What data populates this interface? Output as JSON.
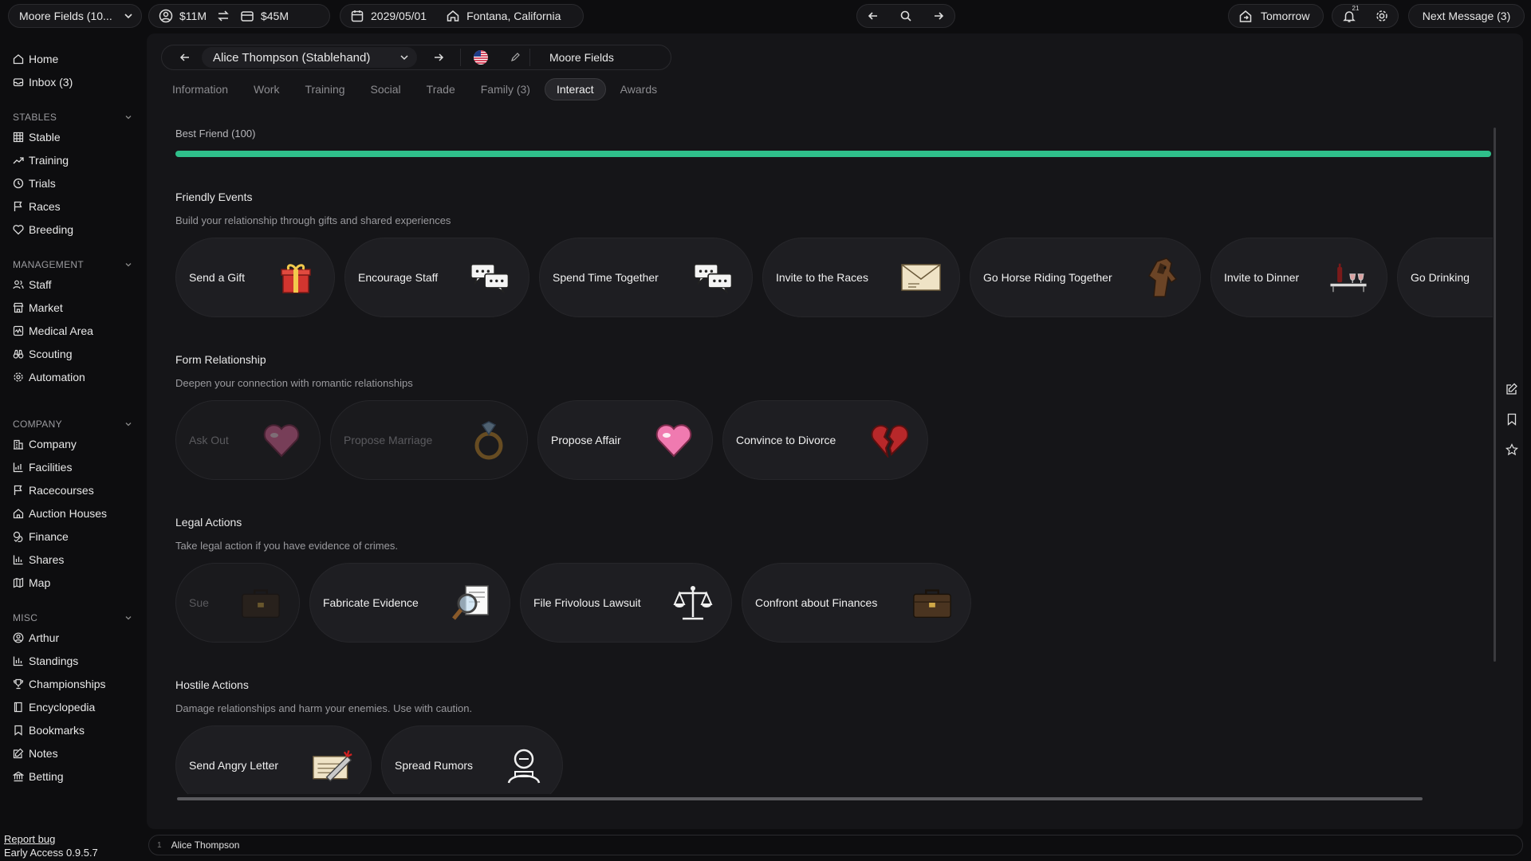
{
  "topbar": {
    "save_select": "Moore Fields (10...",
    "cash": "$11M",
    "assets": "$45M",
    "date": "2029/05/01",
    "location": "Fontana, California",
    "tomorrow": "Tomorrow",
    "notif_count": "21",
    "next_message": "Next Message (3)"
  },
  "sidebar": {
    "top": [
      {
        "label": "Home",
        "icon": "home-icon"
      },
      {
        "label": "Inbox (3)",
        "icon": "inbox-icon"
      }
    ],
    "sections": [
      {
        "title": "STABLES",
        "items": [
          {
            "label": "Stable",
            "icon": "grid-icon"
          },
          {
            "label": "Training",
            "icon": "trend-icon"
          },
          {
            "label": "Trials",
            "icon": "history-icon"
          },
          {
            "label": "Races",
            "icon": "flag-icon"
          },
          {
            "label": "Breeding",
            "icon": "heart-icon"
          }
        ]
      },
      {
        "title": "MANAGEMENT",
        "items": [
          {
            "label": "Staff",
            "icon": "users-icon"
          },
          {
            "label": "Market",
            "icon": "store-icon"
          },
          {
            "label": "Medical Area",
            "icon": "medical-icon"
          },
          {
            "label": "Scouting",
            "icon": "binoculars-icon"
          },
          {
            "label": "Automation",
            "icon": "gear-icon"
          }
        ]
      },
      {
        "title": "COMPANY",
        "items": [
          {
            "label": "Company",
            "icon": "building-icon"
          },
          {
            "label": "Facilities",
            "icon": "chart-icon"
          },
          {
            "label": "Racecourses",
            "icon": "flag-icon"
          },
          {
            "label": "Auction Houses",
            "icon": "house-icon"
          },
          {
            "label": "Finance",
            "icon": "coins-icon"
          },
          {
            "label": "Shares",
            "icon": "bar-chart-icon"
          },
          {
            "label": "Map",
            "icon": "map-icon"
          }
        ]
      },
      {
        "title": "MISC",
        "items": [
          {
            "label": "Arthur",
            "icon": "user-circle-icon"
          },
          {
            "label": "Standings",
            "icon": "bar-chart-icon"
          },
          {
            "label": "Championships",
            "icon": "trophy-icon"
          },
          {
            "label": "Encyclopedia",
            "icon": "book-icon"
          },
          {
            "label": "Bookmarks",
            "icon": "bookmark-icon"
          },
          {
            "label": "Notes",
            "icon": "edit-icon"
          },
          {
            "label": "Betting",
            "icon": "bank-icon"
          }
        ]
      }
    ],
    "report_bug": "Report bug",
    "version": "Early Access 0.9.5.7"
  },
  "profile": {
    "person": "Alice Thompson (Stablehand)",
    "company": "Moore Fields"
  },
  "tabs": [
    {
      "label": "Information",
      "active": false
    },
    {
      "label": "Work",
      "active": false
    },
    {
      "label": "Training",
      "active": false
    },
    {
      "label": "Social",
      "active": false
    },
    {
      "label": "Trade",
      "active": false
    },
    {
      "label": "Family (3)",
      "active": false
    },
    {
      "label": "Interact",
      "active": true
    },
    {
      "label": "Awards",
      "active": false
    }
  ],
  "relationship": {
    "label": "Best Friend (100)",
    "value_percent": 100,
    "color": "#2fbf8a"
  },
  "sections": {
    "friendly": {
      "title": "Friendly Events",
      "desc": "Build your relationship through gifts and shared experiences",
      "cards": [
        {
          "label": "Send a Gift",
          "icon": "gift-icon",
          "disabled": false
        },
        {
          "label": "Encourage Staff",
          "icon": "chat-bubbles-icon",
          "disabled": false
        },
        {
          "label": "Spend Time Together",
          "icon": "chat-bubbles-icon",
          "disabled": false
        },
        {
          "label": "Invite to the Races",
          "icon": "envelope-icon",
          "disabled": false
        },
        {
          "label": "Go Horse Riding Together",
          "icon": "horse-icon",
          "disabled": false
        },
        {
          "label": "Invite to Dinner",
          "icon": "dinner-icon",
          "disabled": false
        },
        {
          "label": "Go Drinking",
          "icon": "beer-icon",
          "disabled": false
        }
      ]
    },
    "romance": {
      "title": "Form Relationship",
      "desc": "Deepen your connection with romantic relationships",
      "cards": [
        {
          "label": "Ask Out",
          "icon": "heart-icon",
          "disabled": true
        },
        {
          "label": "Propose Marriage",
          "icon": "ring-icon",
          "disabled": true
        },
        {
          "label": "Propose Affair",
          "icon": "heart-icon",
          "disabled": false
        },
        {
          "label": "Convince to Divorce",
          "icon": "broken-heart-icon",
          "disabled": false
        }
      ]
    },
    "legal": {
      "title": "Legal Actions",
      "desc": "Take legal action if you have evidence of crimes.",
      "cards": [
        {
          "label": "Sue",
          "icon": "briefcase-icon",
          "disabled": true
        },
        {
          "label": "Fabricate Evidence",
          "icon": "magnifier-icon",
          "disabled": false
        },
        {
          "label": "File Frivolous Lawsuit",
          "icon": "scales-icon",
          "disabled": false
        },
        {
          "label": "Confront about Finances",
          "icon": "briefcase-icon",
          "disabled": false
        }
      ]
    },
    "hostile": {
      "title": "Hostile Actions",
      "desc": "Damage relationships and harm your enemies. Use with caution.",
      "cards": [
        {
          "label": "Send Angry Letter",
          "icon": "angry-letter-icon",
          "disabled": false
        },
        {
          "label": "Spread Rumors",
          "icon": "gossip-icon",
          "disabled": false
        }
      ]
    }
  },
  "statusbar": {
    "index": "1",
    "name": "Alice Thompson"
  }
}
